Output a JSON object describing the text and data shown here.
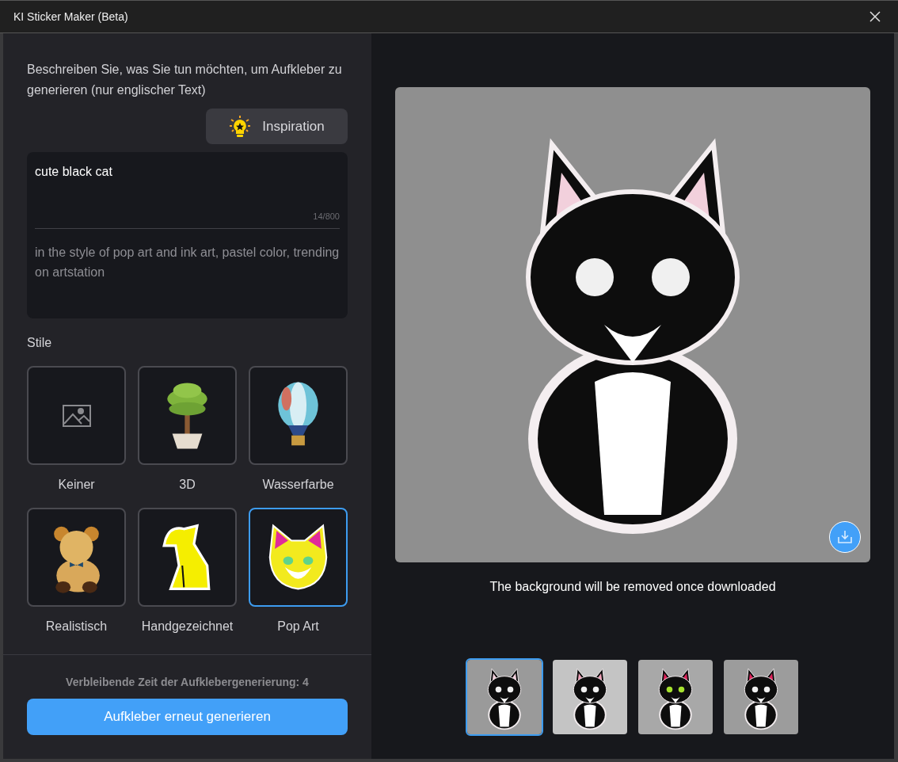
{
  "window": {
    "title": "KI Sticker Maker (Beta)"
  },
  "prompt": {
    "instruction": "Beschreiben Sie, was Sie tun möchten, um Aufkleber zu generieren (nur englischer Text)",
    "inspiration_button": "Inspiration",
    "value": "cute black cat",
    "counter": "14/800",
    "style_suffix": "in the style of pop art and ink art, pastel color, trending on artstation"
  },
  "styles_label": "Stile",
  "styles": [
    {
      "label": "Keiner",
      "kind": "none",
      "selected": false
    },
    {
      "label": "3D",
      "kind": "picture",
      "selected": false
    },
    {
      "label": "Wasserfarbe",
      "kind": "picture",
      "selected": false
    },
    {
      "label": "Realistisch",
      "kind": "picture",
      "selected": false
    },
    {
      "label": "Handgezeichnet",
      "kind": "picture",
      "selected": false
    },
    {
      "label": "Pop Art",
      "kind": "picture",
      "selected": true
    }
  ],
  "remaining": "Verbleibende Zeit der Aufklebergenerierung: 4",
  "generate_button": "Aufkleber erneut generieren",
  "preview": {
    "caption": "The background will be removed once downloaded"
  },
  "thumbnails": [
    {
      "kind": "picture",
      "selected": true
    },
    {
      "kind": "picture",
      "selected": false
    },
    {
      "kind": "picture",
      "selected": false
    },
    {
      "kind": "picture",
      "selected": false
    }
  ]
}
